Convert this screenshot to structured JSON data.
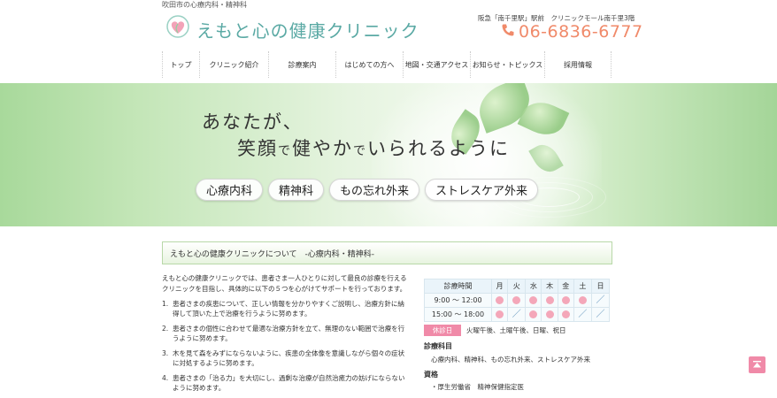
{
  "header": {
    "tagline": "吹田市の心療内科・精神科",
    "site_title": "えもと心の健康クリニック",
    "access": "阪急「南千里駅」駅前　クリニックモール南千里3階",
    "phone": "06-6836-6777",
    "logo_icon": "heart-leaf-logo-icon",
    "phone_icon": "phone-handset-icon"
  },
  "nav": {
    "items": [
      {
        "label": "トップ"
      },
      {
        "label": "クリニック紹介"
      },
      {
        "label": "診療案内"
      },
      {
        "label": "はじめての方へ"
      },
      {
        "label": "地図・交通アクセス"
      },
      {
        "label": "お知らせ・トピックス"
      },
      {
        "label": "採用情報"
      }
    ]
  },
  "hero": {
    "line1": "あなたが、",
    "line2_a": "笑顔",
    "line2_b": "で",
    "line2_c": "健やか",
    "line2_d": "で",
    "line2_e": "いられるように",
    "pills": [
      "心療内科",
      "精神科",
      "もの忘れ外来",
      "ストレスケア外来"
    ]
  },
  "about": {
    "heading": "えもと心の健康クリニックについて　-心療内科・精神科-",
    "intro": "えもと心の健康クリニックでは、患者さま一人ひとりに対して最良の診療を行えるクリニックを目指し、具体的に以下の５つを心がけてサポートを行っております。",
    "items": [
      {
        "num": "1.",
        "text": "患者さまの疾患について、正しい情報を分かりやすくご説明し、治療方針に納得して頂いた上で治療を行うように努めます。"
      },
      {
        "num": "2.",
        "text": "患者さまの個性に合わせて最適な治療方針を立て、無理のない範囲で治療を行うように努めます。"
      },
      {
        "num": "3.",
        "text": "木を見て森をみずにならないように、疾患の全体像を意識しながら個々の症状に対処するように努めます。"
      },
      {
        "num": "4.",
        "text": "患者さまの「治る力」を大切にし、過剰な治療が自然治癒力の妨げにならないように努めます。"
      }
    ]
  },
  "schedule": {
    "header_label": "診療時間",
    "days": [
      "月",
      "火",
      "水",
      "木",
      "金",
      "土",
      "日"
    ],
    "rows": [
      {
        "time": "9:00 ～ 12:00",
        "marks": [
          "open",
          "open",
          "open",
          "open",
          "open",
          "open",
          "closed"
        ]
      },
      {
        "time": "15:00 ～ 18:00",
        "marks": [
          "open",
          "closed",
          "open",
          "open",
          "open",
          "closed",
          "closed"
        ]
      }
    ],
    "closed_label": "休診日",
    "closed_days": "火曜午後、土曜午後、日曜、祝日",
    "open_color": "#f4a7b9",
    "accent": "#f08aa8"
  },
  "departments": {
    "heading": "診療科目",
    "body": "心療内科、精神科、もの忘れ外来、ストレスケア外来"
  },
  "qualifications": {
    "heading": "資格",
    "body": "・厚生労働省　精神保健指定医"
  },
  "page_top": {
    "icon": "arrow-up-icon"
  }
}
